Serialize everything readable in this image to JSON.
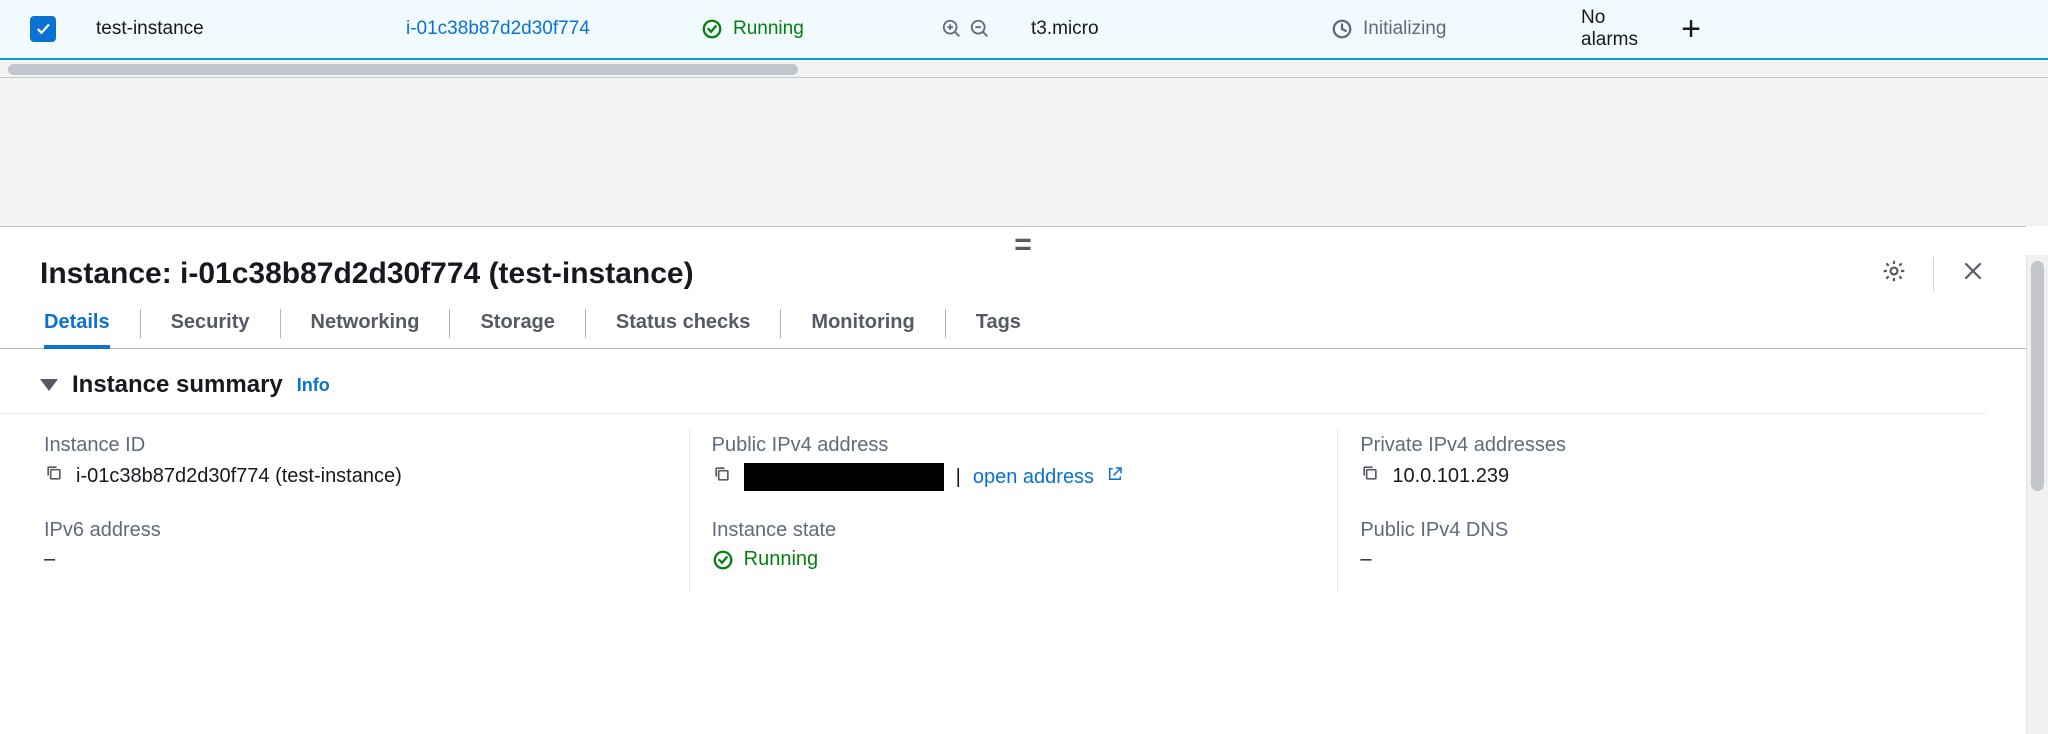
{
  "row": {
    "name": "test-instance",
    "id": "i-01c38b87d2d30f774",
    "state": "Running",
    "type": "t3.micro",
    "status": "Initializing",
    "alarms": "No alarms"
  },
  "panel": {
    "title": "Instance: i-01c38b87d2d30f774 (test-instance)"
  },
  "tabs": [
    "Details",
    "Security",
    "Networking",
    "Storage",
    "Status checks",
    "Monitoring",
    "Tags"
  ],
  "section": {
    "title": "Instance summary",
    "info": "Info"
  },
  "summary": {
    "instance_id_label": "Instance ID",
    "instance_id_value": "i-01c38b87d2d30f774 (test-instance)",
    "public_ipv4_label": "Public IPv4 address",
    "open_address": "open address",
    "private_ipv4_label": "Private IPv4 addresses",
    "private_ipv4_value": "10.0.101.239",
    "ipv6_label": "IPv6 address",
    "ipv6_value": "–",
    "instance_state_label": "Instance state",
    "instance_state_value": "Running",
    "public_dns_label": "Public IPv4 DNS",
    "public_dns_value": "–"
  }
}
